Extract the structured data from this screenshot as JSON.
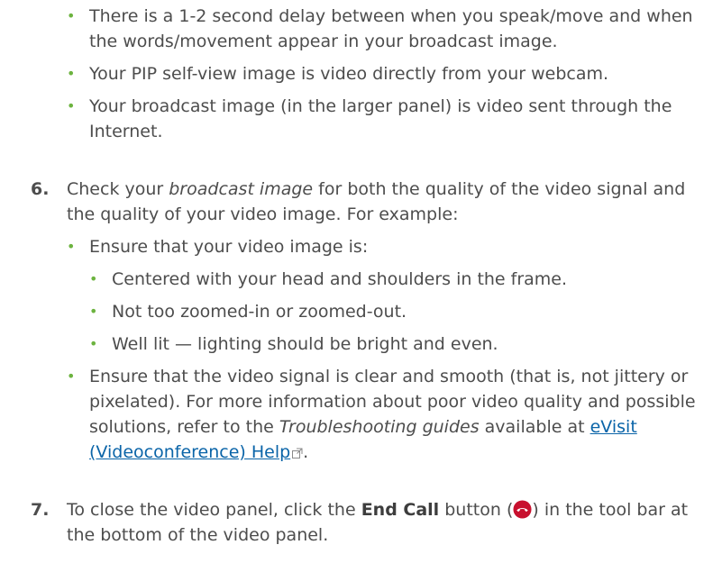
{
  "intro_bullets": [
    "There is a 1-2 second delay between when you speak/move and when the words/movement appear in your broadcast image.",
    "Your PIP self-view image is video directly from your webcam.",
    "Your broadcast image (in the larger panel) is video sent through the Internet."
  ],
  "step6": {
    "number": "6.",
    "text_before": "Check your ",
    "text_emph": "broadcast image",
    "text_after": " for both the quality of the video signal and the quality of your video image. For example:",
    "bullets": {
      "ensure_image": "Ensure that your video image is:",
      "image_items": [
        "Centered with your head and shoulders in the frame.",
        "Not too zoomed-in or zoomed-out.",
        "Well lit — lighting should be bright and even."
      ],
      "signal_before": "Ensure that the video signal is clear and smooth (that is, not jittery or pixelated). For more information about poor video quality and possible solutions, refer to the ",
      "signal_emph": "Troubleshooting guides",
      "signal_mid": " available at ",
      "signal_link": "eVisit (Videoconference) Help",
      "signal_end": "."
    }
  },
  "step7": {
    "number": "7.",
    "text_before": "To close the video panel, click the ",
    "text_bold": "End Call",
    "text_mid": " button (",
    "text_after": ") in the tool bar at the bottom of the video panel."
  },
  "colors": {
    "bullet": "#6cb33f",
    "link": "#0a64a8",
    "end_call": "#c8102e",
    "text": "#4d4d4d"
  },
  "icons": {
    "bullet": "bullet-icon",
    "external_link": "external-link-icon",
    "end_call": "end-call-icon"
  }
}
